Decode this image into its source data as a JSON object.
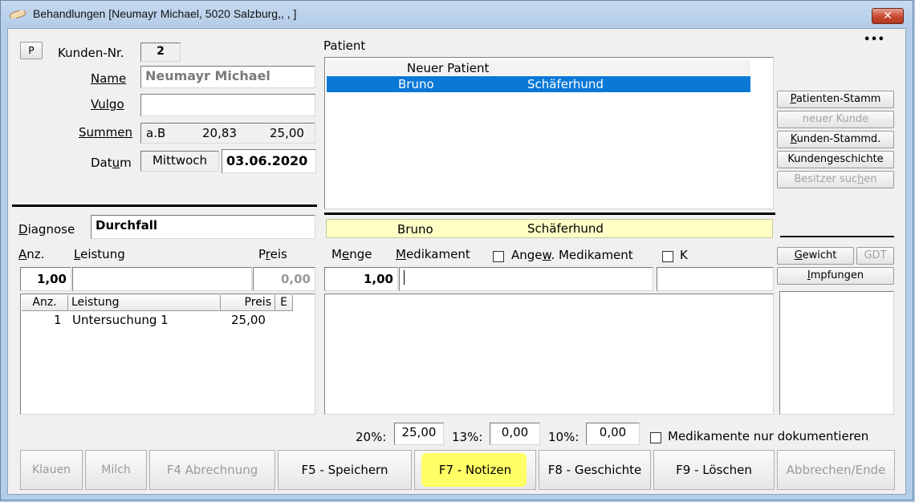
{
  "window": {
    "title": "Behandlungen [Neumayr Michael, 5020 Salzburg,, , ]",
    "close": "✕",
    "more": "• • •"
  },
  "customer": {
    "p_button": "P",
    "kunden_nr_label": "Kunden-Nr.",
    "kunden_nr": "2",
    "name_label": "Name",
    "name": "Neumayr Michael",
    "vulgo_label": "Vulgo",
    "vulgo": "",
    "summen_label": "Summen",
    "summen_ab": "a.B",
    "summen_val1": "20,83",
    "summen_val2": "25,00",
    "datum_label": "Datum",
    "weekday": "Mittwoch",
    "date": "03.06.2020"
  },
  "patient": {
    "label": "Patient",
    "list": [
      {
        "name": "Neuer Patient",
        "breed": ""
      },
      {
        "name": "Bruno",
        "breed": "Schäferhund"
      }
    ],
    "current_name": "Bruno",
    "current_breed": "Schäferhund"
  },
  "side_buttons": {
    "patienten_stamm": "Patienten-Stamm",
    "neuer_kunde": "neuer Kunde",
    "kunden_stammd": "Kunden-Stammd.",
    "kundengeschichte": "Kundengeschichte",
    "besitzer_suchen": "Besitzer suchen",
    "gewicht": "Gewicht",
    "gdt": "GDT",
    "impfungen": "Impfungen"
  },
  "diagnose": {
    "label": "Diagnose",
    "value": "Durchfall"
  },
  "leistung": {
    "anz_label": "Anz.",
    "leistung_label": "Leistung",
    "preis_label": "Preis",
    "anz_value": "1,00",
    "leistung_value": "",
    "preis_value": "0,00",
    "columns": [
      "Anz.",
      "Leistung",
      "Preis",
      "E"
    ],
    "rows": [
      {
        "anz": "1",
        "leistung": "Untersuchung 1",
        "preis": "25,00",
        "e": ""
      }
    ]
  },
  "medikament": {
    "menge_label": "Menge",
    "medikament_label": "Medikament",
    "angew_label": "Angew. Medikament",
    "angew_checked": false,
    "k_label": "K",
    "k_checked": false,
    "menge_value": "1,00",
    "medikament_value": "",
    "extra_value": ""
  },
  "totals": {
    "tax20_label": "20%:",
    "tax20": "25,00",
    "tax13_label": "13%:",
    "tax13": "0,00",
    "tax10_label": "10%:",
    "tax10": "0,00",
    "doc_only_label": "Medikamente nur dokumentieren",
    "doc_only_checked": false
  },
  "bottom_buttons": {
    "klauen": "Klauen",
    "milch": "Milch",
    "abrechnung": "F4 Abrechnung",
    "speichern": "F5 - Speichern",
    "notizen": "F7 - Notizen",
    "geschichte": "F8 - Geschichte",
    "loeschen": "F9 - Löschen",
    "abbrechen": "Abbrechen/Ende"
  },
  "colors": {
    "selection": "#0a78d7",
    "highlight_yellow": "#ffff66",
    "info_bar": "#ffffc6"
  }
}
